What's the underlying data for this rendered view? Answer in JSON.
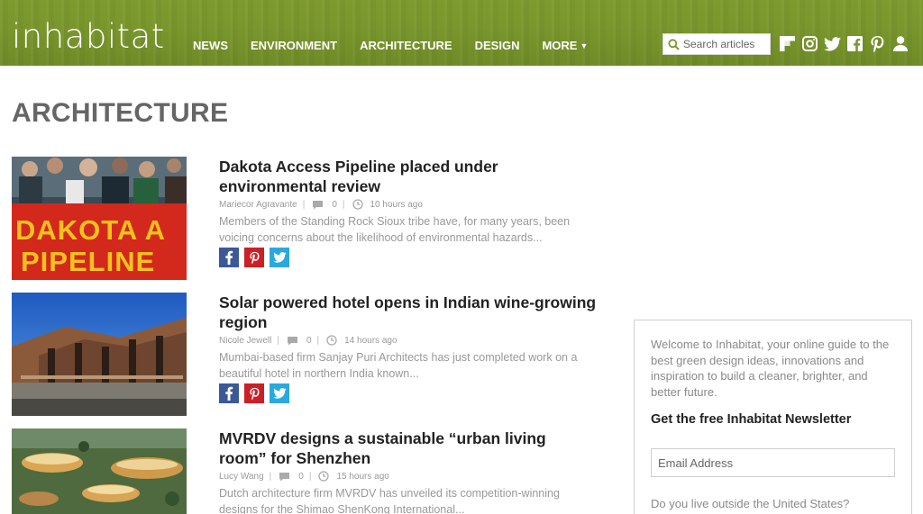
{
  "brand": {
    "logo_text": "inhabitat"
  },
  "nav": [
    {
      "label": "NEWS"
    },
    {
      "label": "ENVIRONMENT"
    },
    {
      "label": "ARCHITECTURE"
    },
    {
      "label": "DESIGN"
    },
    {
      "label": "MORE"
    }
  ],
  "search": {
    "placeholder": "Search articles"
  },
  "social_icons": [
    "flipboard-icon",
    "instagram-icon",
    "twitter-icon",
    "facebook-icon",
    "pinterest-icon",
    "user-icon"
  ],
  "page": {
    "title": "ARCHITECTURE"
  },
  "articles": [
    {
      "title": "Dakota Access Pipeline placed under environmental review",
      "author": "Mariecor Agravante",
      "comments": "0",
      "time": "10 hours ago",
      "excerpt": "Members of the Standing Rock Sioux tribe have, for many years, been voicing concerns about the likelihood of environmental hazards...",
      "thumb_text": "DAKOTA A\nPIPELINE"
    },
    {
      "title": "Solar powered hotel opens in Indian wine-growing region",
      "author": "Nicole Jewell",
      "comments": "0",
      "time": "14 hours ago",
      "excerpt": "Mumbai-based firm Sanjay Puri Architects has just completed work on a beautiful hotel in northern India known..."
    },
    {
      "title": "MVRDV designs a sustainable “urban living room” for Shenzhen",
      "author": "Lucy Wang",
      "comments": "0",
      "time": "15 hours ago",
      "excerpt": "Dutch architecture firm MVRDV has unveiled its competition-winning designs for the Shimao ShenKong International..."
    }
  ],
  "sidebar": {
    "intro": "Welcome to Inhabitat, your online guide to the best green design ideas, innovations and inspiration to build a cleaner, brighter, and better future.",
    "newsletter_title": "Get the free Inhabitat Newsletter",
    "email_placeholder": "Email Address",
    "outside_question": "Do you live outside the United States?"
  },
  "colors": {
    "header_green": "#7a972d",
    "facebook": "#3b5998",
    "pinterest": "#cb2027",
    "twitter": "#2aa9e0"
  }
}
